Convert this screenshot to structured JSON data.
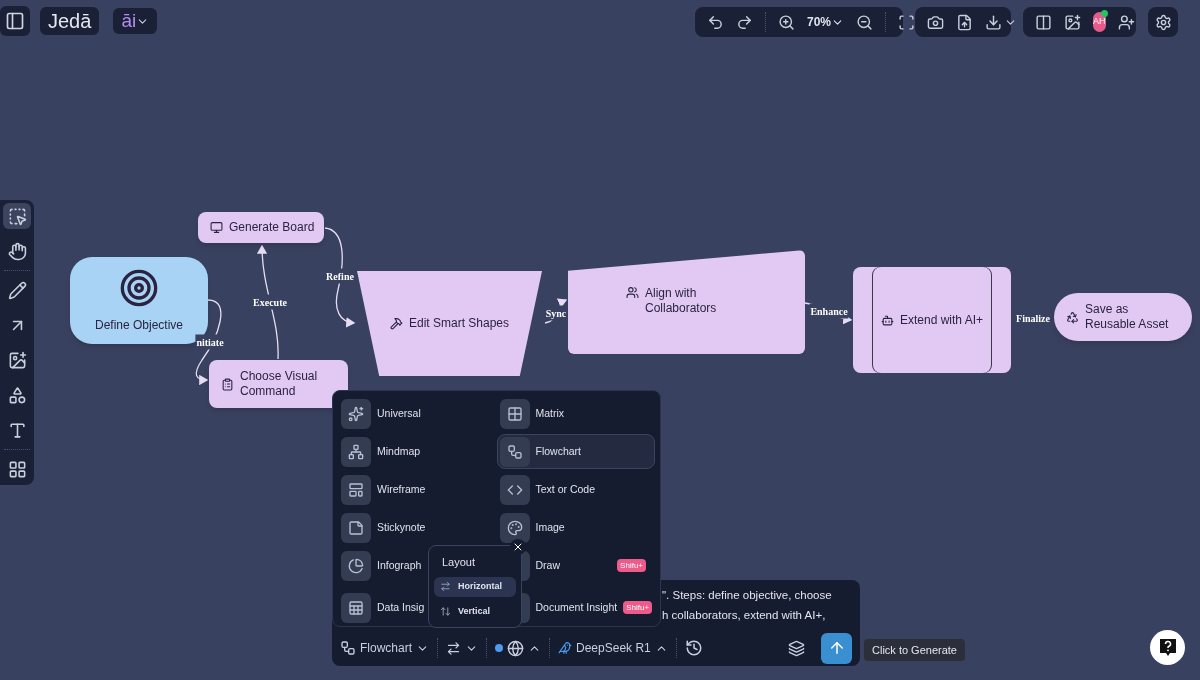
{
  "top_bar": {
    "logo": "Jedā",
    "ai_label": "āi",
    "zoom": "70%",
    "avatar": "AH"
  },
  "tools": [
    {
      "selected": true
    },
    {
      "selected": false
    },
    {
      "selected": false
    },
    {
      "selected": false
    },
    {
      "selected": false
    },
    {
      "selected": false
    },
    {
      "selected": false
    },
    {
      "selected": false
    }
  ],
  "flowchart": {
    "nodes": [
      {
        "label": "Define Objective",
        "kind": "rounded"
      },
      {
        "label": "Generate Board",
        "kind": "box"
      },
      {
        "label": "Choose Visual Command",
        "kind": "box"
      },
      {
        "label": "Edit Smart Shapes",
        "kind": "trapezoid"
      },
      {
        "label": "Align with Collaborators",
        "kind": "slanted"
      },
      {
        "label": "Extend with AI+",
        "kind": "process"
      },
      {
        "label": "Save as Reusable Asset",
        "kind": "pill"
      }
    ],
    "edges": [
      {
        "label": "nitiate"
      },
      {
        "label": "Execute"
      },
      {
        "label": "Refine"
      },
      {
        "label": "Sync"
      },
      {
        "label": "Enhance"
      },
      {
        "label": "Finalize"
      }
    ]
  },
  "type_menu": {
    "items": [
      {
        "label": "Universal",
        "selected": false
      },
      {
        "label": "Matrix",
        "selected": false
      },
      {
        "label": "Mindmap",
        "selected": false
      },
      {
        "label": "Flowchart",
        "selected": true
      },
      {
        "label": "Wireframe",
        "selected": false
      },
      {
        "label": "Text or Code",
        "selected": false
      },
      {
        "label": "Stickynote",
        "selected": false
      },
      {
        "label": "Image",
        "selected": false
      },
      {
        "label": "Infograph",
        "selected": false
      },
      {
        "label": "Draw",
        "selected": false,
        "badge": "Shifu+"
      },
      {
        "label": "Data Insig",
        "selected": false
      },
      {
        "label": "Document Insight",
        "selected": false,
        "badge": "Shifu+"
      }
    ]
  },
  "layout_menu": {
    "title": "Layout",
    "options": [
      {
        "label": "Horizontal",
        "selected": true
      },
      {
        "label": "Vertical",
        "selected": false
      }
    ]
  },
  "prompt": {
    "lines": [
      "\". Steps: define objective, choose",
      "h collaborators, extend with AI+,"
    ],
    "diagram_type": "Flowchart",
    "model": "DeepSeek R1",
    "search_on": true
  },
  "tooltip": "Click to Generate"
}
